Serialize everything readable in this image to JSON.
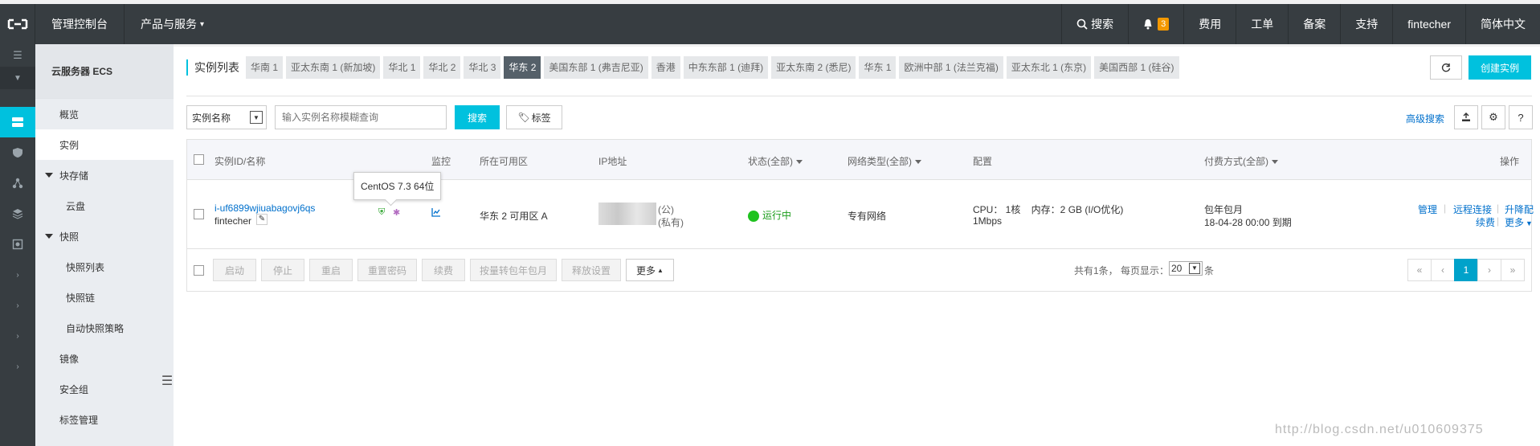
{
  "topbar": {
    "console": "管理控制台",
    "products": "产品与服务",
    "search": "搜索",
    "notif_count": "3",
    "fees": "费用",
    "tickets": "工单",
    "icp": "备案",
    "support": "支持",
    "user": "fintecher",
    "lang": "简体中文"
  },
  "sidebar": {
    "title": "云服务器 ECS",
    "items": [
      {
        "label": "概览"
      },
      {
        "label": "实例"
      },
      {
        "label": "块存储"
      },
      {
        "label": "云盘"
      },
      {
        "label": "快照"
      },
      {
        "label": "快照列表"
      },
      {
        "label": "快照链"
      },
      {
        "label": "自动快照策略"
      },
      {
        "label": "镜像"
      },
      {
        "label": "安全组"
      },
      {
        "label": "标签管理"
      }
    ]
  },
  "page": {
    "title": "实例列表",
    "regions": [
      "华南 1",
      "亚太东南 1 (新加坡)",
      "华北 1",
      "华北 2",
      "华北 3",
      "华东 2",
      "美国东部 1 (弗吉尼亚)",
      "香港",
      "中东东部 1 (迪拜)",
      "亚太东南 2 (悉尼)",
      "华东 1",
      "欧洲中部 1 (法兰克福)",
      "亚太东北 1 (东京)",
      "美国西部 1 (硅谷)"
    ],
    "active_region": "华东 2",
    "create_label": "创建实例",
    "refresh_icon": "refresh-icon"
  },
  "search": {
    "field_label": "实例名称",
    "placeholder": "输入实例名称模糊查询",
    "button": "搜索",
    "tag_button": "标签",
    "advanced": "高级搜索"
  },
  "table": {
    "headers": {
      "id": "实例ID/名称",
      "monitor": "监控",
      "zone": "所在可用区",
      "ip": "IP地址",
      "status": "状态(全部)",
      "network": "网络类型(全部)",
      "config": "配置",
      "billing": "付费方式(全部)",
      "ops": "操作"
    },
    "row": {
      "id": "i-uf6899wjiuabagovj6qs",
      "name": "fintecher",
      "tooltip": "CentOS 7.3 64位",
      "zone": "华东 2 可用区 A",
      "ip_public": "(公)",
      "ip_private": "(私有)",
      "status": "运行中",
      "network": "专有网络",
      "config_line1": "CPU： 1核    内存：2 GB (I/O优化)",
      "config_line2": "1Mbps",
      "billing_line1": "包年包月",
      "billing_line2": "18-04-28 00:00 到期",
      "op_manage": "管理",
      "op_remote": "远程连接",
      "op_upgrade": "升降配",
      "op_renew": "续费",
      "op_more": "更多"
    },
    "footer": {
      "buttons": [
        "启动",
        "停止",
        "重启",
        "重置密码",
        "续费",
        "按量转包年包月",
        "释放设置"
      ],
      "more": "更多",
      "total_prefix": "共有1条， 每页显示：",
      "page_size": "20",
      "total_suffix": "条",
      "pages": [
        "«",
        "‹",
        "1",
        "›",
        "»"
      ],
      "current_page": "1"
    }
  },
  "watermark": "http://blog.csdn.net/u010609375",
  "colors": {
    "topbar": "#373d41",
    "accent": "#00c1de",
    "link": "#0070cc",
    "running": "#1fc21f"
  }
}
